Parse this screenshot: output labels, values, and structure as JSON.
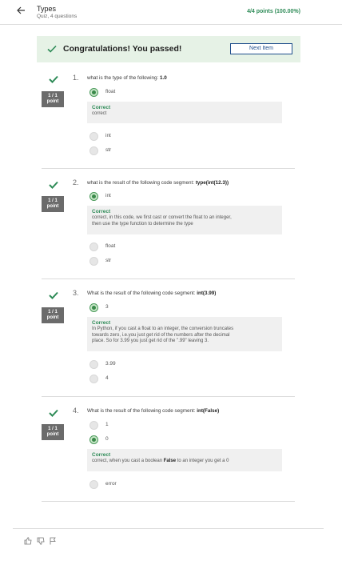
{
  "header": {
    "title": "Types",
    "subtitle": "Quiz, 4 questions",
    "points": "4/4 points (100.00%)"
  },
  "banner": {
    "message": "Congratulations! You passed!",
    "next_label": "Next Item"
  },
  "questions": [
    {
      "number": "1.",
      "prompt": "what is the type of the following:",
      "code": "1.0",
      "badge_score": "1 / 1",
      "badge_unit": "point",
      "selected": "float",
      "feedback_title": "Correct",
      "feedback_lines": [
        "correct"
      ],
      "others": [
        "int",
        "str"
      ]
    },
    {
      "number": "2.",
      "prompt": "what is the result of the following code segment:",
      "code": "type(int(12.3))",
      "badge_score": "1 / 1",
      "badge_unit": "point",
      "selected": "int",
      "feedback_title": "Correct",
      "feedback_lines": [
        "correct, in this code, we first cast or convert the float to an integer,",
        "then use the type function to determine the type"
      ],
      "others": [
        "float",
        "str"
      ]
    },
    {
      "number": "3.",
      "prompt": "What is the result of the following code segment:",
      "code": "int(3.99)",
      "badge_score": "1 / 1",
      "badge_unit": "point",
      "selected": "3",
      "feedback_title": "Correct",
      "feedback_lines": [
        "In Python, if you cast a float to an integer, the conversion truncates",
        "towards zero, i.e.you just get rid of the numbers after the decimal",
        "place. So for 3.99 you just get rid of the \".99\" leaving 3."
      ],
      "others": [
        "3.99",
        "4"
      ]
    },
    {
      "number": "4.",
      "prompt": "What is the result of the following code segment:",
      "code": "int(False)",
      "badge_score": "1 / 1",
      "badge_unit": "point",
      "first_option": "1",
      "selected": "0",
      "feedback_title": "Correct",
      "feedback_pre": "correct, when you cast a boolean",
      "feedback_bold": "False",
      "feedback_post": "to an integer you get a 0",
      "others": [
        "error"
      ]
    }
  ],
  "colors": {
    "success": "#2e8b57",
    "banner_bg": "#e6f2e6",
    "badge_bg": "#6b6b6b",
    "link": "#1f4e8c"
  }
}
